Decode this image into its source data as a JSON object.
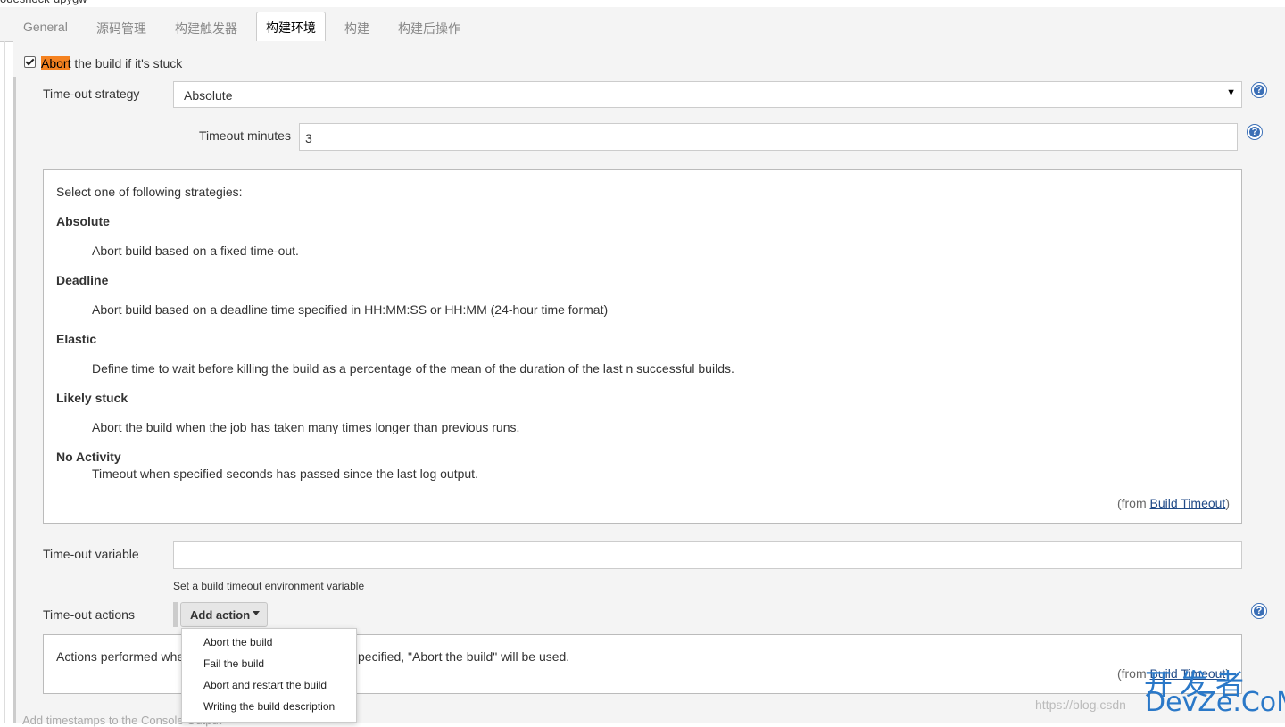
{
  "header": {
    "crumb": "odeshock-dpygw"
  },
  "tabs": [
    {
      "label": "General"
    },
    {
      "label": "源码管理"
    },
    {
      "label": "构建触发器"
    },
    {
      "label": "构建环境"
    },
    {
      "label": "构建"
    },
    {
      "label": "构建后操作"
    }
  ],
  "abort": {
    "checked": true,
    "highlight": "Abort",
    "rest": " the build if it's stuck"
  },
  "strategy": {
    "label": "Time-out strategy",
    "value": "Absolute",
    "arrow": "▼"
  },
  "timeout": {
    "label": "Timeout minutes",
    "value": "3"
  },
  "help_icon": "?",
  "help": {
    "intro": "Select one of following strategies:",
    "items": [
      {
        "name": "Absolute",
        "desc": "Abort build based on a fixed time-out."
      },
      {
        "name": "Deadline",
        "desc": "Abort build based on a deadline time specified in HH:MM:SS or HH:MM (24-hour time format)"
      },
      {
        "name": "Elastic",
        "desc": "Define time to wait before killing the build as a percentage of the mean of the duration of the last n successful builds."
      },
      {
        "name": "Likely stuck",
        "desc": "Abort the build when the job has taken many times longer than previous runs."
      },
      {
        "name": "No Activity",
        "desc": "Timeout when specified seconds has passed since the last log output."
      }
    ],
    "from_prefix": "(from ",
    "from_link": "Build Timeout",
    "from_suffix": ")"
  },
  "variable": {
    "label": "Time-out variable",
    "value": "",
    "hint": "Set a build timeout environment variable"
  },
  "actions": {
    "label": "Time-out actions",
    "button": "Add action",
    "desc_left": "Actions performed whe",
    "desc_right": "pecified, \"Abort the build\" will be used.",
    "from_prefix": "(from ",
    "from_link": "Build Timeout",
    "from_suffix": ")",
    "menu": [
      "Abort the build",
      "Fail the build",
      "Abort and restart the build",
      "Writing the build description"
    ]
  },
  "bottom": {
    "label": "Add timestamps to the Console Output"
  },
  "watermark": "https://blog.csdn",
  "logo": {
    "cn": "开发者",
    "en": "DevZe.CoM"
  },
  "colors": {
    "highlight": "#f58220",
    "help_blue": "#3b6fb6",
    "link": "#204a87",
    "logo": "#2a78c8"
  }
}
